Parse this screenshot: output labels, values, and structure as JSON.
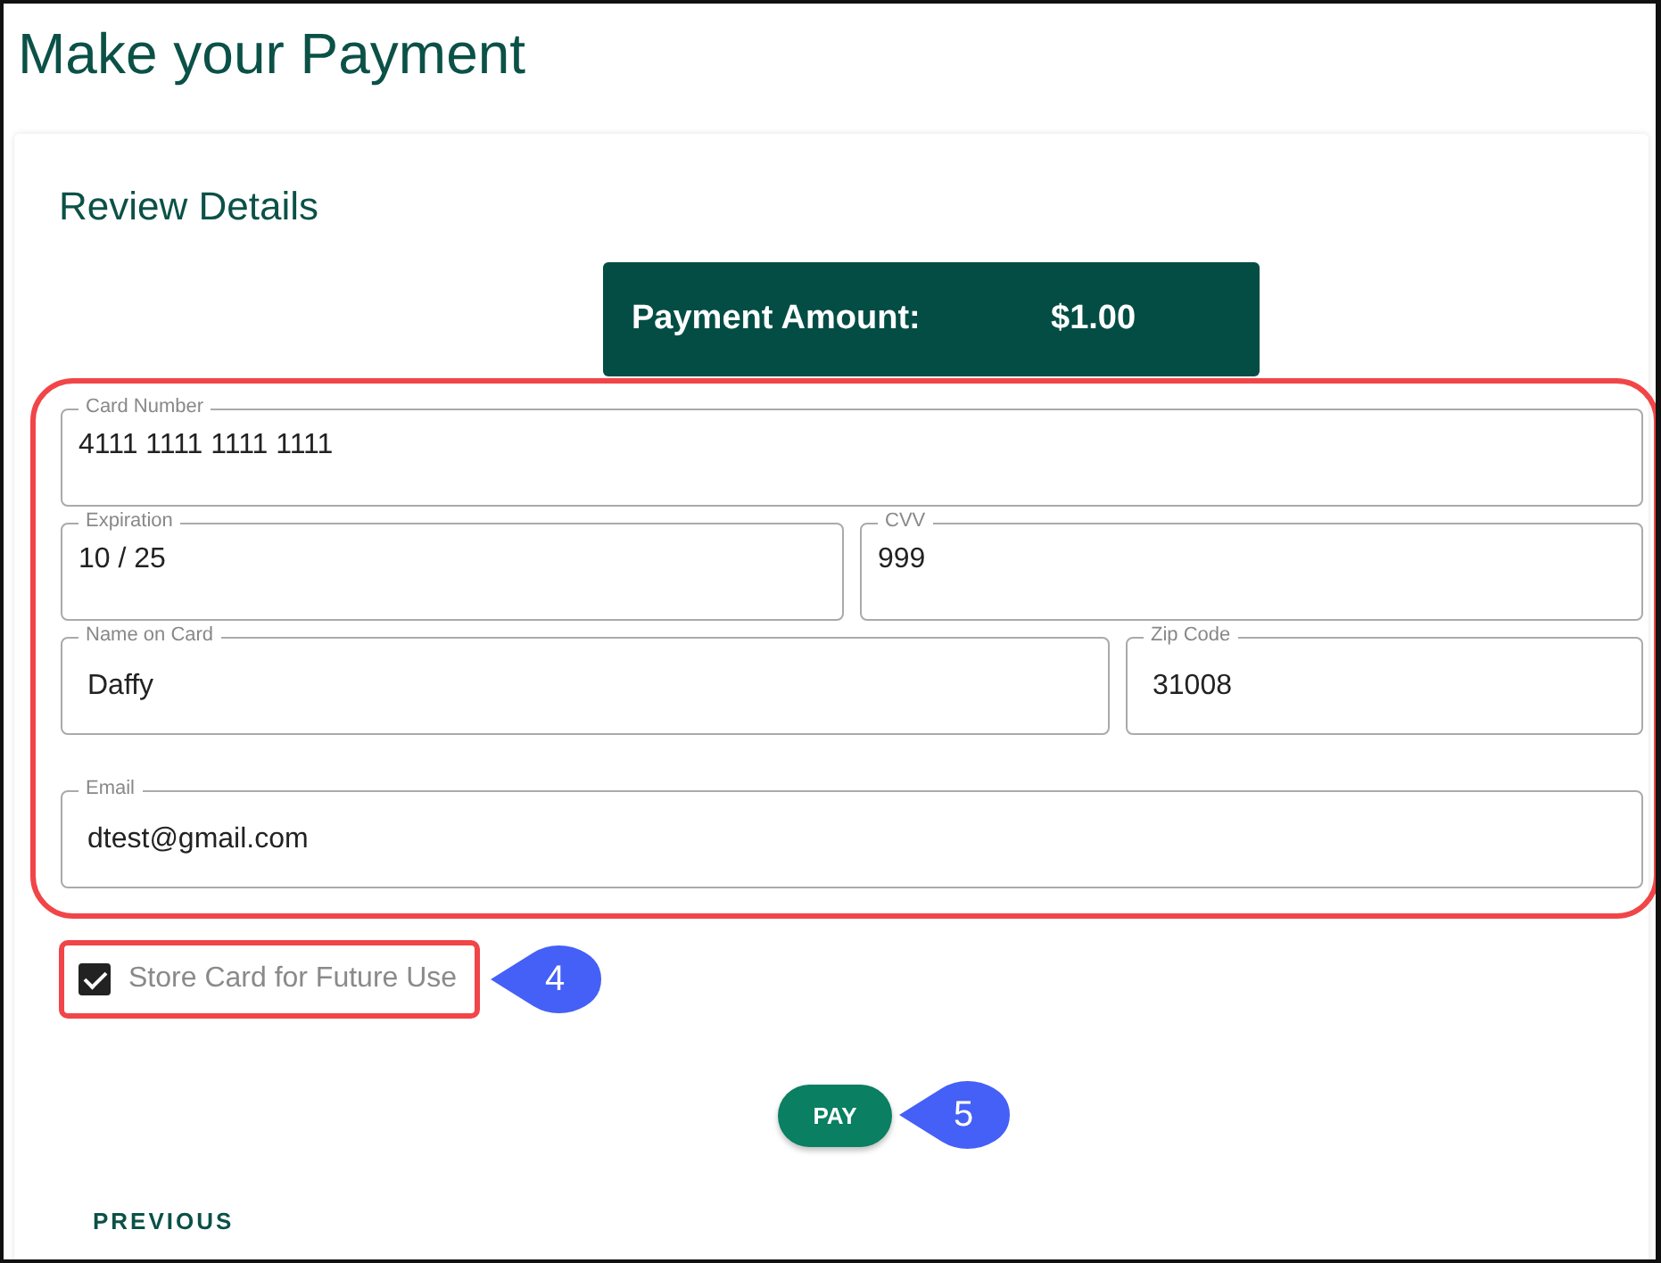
{
  "page_title": "Make your Payment",
  "section_title": "Review Details",
  "payment_amount": {
    "label": "Payment Amount:",
    "value": "$1.00"
  },
  "fields_highlighted": true,
  "field_rows": [
    [
      {
        "label": "Card Number",
        "value": "4111 1111 1111 1111",
        "kind": "wide"
      }
    ],
    [
      {
        "label": "Expiration",
        "value": "10 / 25",
        "kind": "wide"
      },
      {
        "label": "CVV",
        "value": "999",
        "kind": "wide"
      }
    ],
    [
      {
        "label": "Name on Card",
        "value": "Daffy",
        "kind": "wide"
      },
      {
        "label": "Zip Code",
        "value": "31008",
        "kind": "short"
      }
    ],
    [
      {
        "label": "Email",
        "value": "dtest@gmail.com",
        "kind": "wide"
      }
    ]
  ],
  "store_card": {
    "label": "Store Card for Future Use",
    "checked": true,
    "highlighted": true,
    "callout": "4"
  },
  "pay_button": {
    "label": "PAY",
    "callout": "5"
  },
  "previous_button": {
    "label": "PREVIOUS"
  }
}
